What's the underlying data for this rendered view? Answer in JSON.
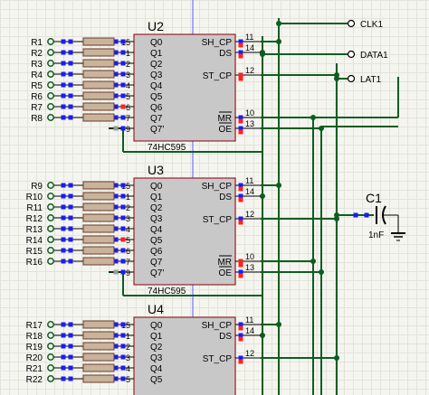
{
  "chips": [
    {
      "ref": "U2",
      "part": "74HC595",
      "left_pins": [
        {
          "num": "15",
          "name": "Q0"
        },
        {
          "num": "1",
          "name": "Q1"
        },
        {
          "num": "2",
          "name": "Q2"
        },
        {
          "num": "3",
          "name": "Q3"
        },
        {
          "num": "4",
          "name": "Q4"
        },
        {
          "num": "5",
          "name": "Q5"
        },
        {
          "num": "6",
          "name": "Q6"
        },
        {
          "num": "7",
          "name": "Q7"
        },
        {
          "num": "9",
          "name": "Q7'"
        }
      ],
      "right_pins": [
        {
          "num": "11",
          "name": "SH_CP"
        },
        {
          "num": "14",
          "name": "DS"
        },
        {
          "num": "12",
          "name": "ST_CP"
        },
        {
          "num": "10",
          "name": "MR"
        },
        {
          "num": "13",
          "name": "OE"
        }
      ],
      "resistors": [
        "R1",
        "R2",
        "R3",
        "R4",
        "R5",
        "R6",
        "R7",
        "R8"
      ]
    },
    {
      "ref": "U3",
      "part": "74HC595",
      "left_pins": [
        {
          "num": "15",
          "name": "Q0"
        },
        {
          "num": "1",
          "name": "Q1"
        },
        {
          "num": "2",
          "name": "Q2"
        },
        {
          "num": "3",
          "name": "Q3"
        },
        {
          "num": "4",
          "name": "Q4"
        },
        {
          "num": "5",
          "name": "Q5"
        },
        {
          "num": "6",
          "name": "Q6"
        },
        {
          "num": "7",
          "name": "Q7"
        },
        {
          "num": "9",
          "name": "Q7'"
        }
      ],
      "right_pins": [
        {
          "num": "11",
          "name": "SH_CP"
        },
        {
          "num": "14",
          "name": "DS"
        },
        {
          "num": "12",
          "name": "ST_CP"
        },
        {
          "num": "10",
          "name": "MR"
        },
        {
          "num": "13",
          "name": "OE"
        }
      ],
      "resistors": [
        "R9",
        "R10",
        "R11",
        "R12",
        "R13",
        "R14",
        "R15",
        "R16"
      ]
    },
    {
      "ref": "U4",
      "part": "",
      "left_pins": [
        {
          "num": "15",
          "name": "Q0"
        },
        {
          "num": "1",
          "name": "Q1"
        },
        {
          "num": "2",
          "name": "Q2"
        },
        {
          "num": "3",
          "name": "Q3"
        },
        {
          "num": "4",
          "name": "Q4"
        },
        {
          "num": "5",
          "name": "Q5"
        }
      ],
      "right_pins": [
        {
          "num": "11",
          "name": "SH_CP"
        },
        {
          "num": "14",
          "name": "DS"
        },
        {
          "num": "12",
          "name": "ST_CP"
        }
      ],
      "resistors": [
        "R17",
        "R18",
        "R19",
        "R20",
        "R21",
        "R22"
      ]
    }
  ],
  "terminals": [
    {
      "label": "CLK1"
    },
    {
      "label": "DATA1"
    },
    {
      "label": "LAT1"
    }
  ],
  "capacitor": {
    "ref": "C1",
    "value": "1nF"
  },
  "colors": {
    "wire": "#0b5e1f",
    "body_fill": "#c8c8c8",
    "body_stroke": "#8b0000",
    "pin_active": "#1a1aff",
    "pin_red": "#ff2020",
    "pin_gray": "#9a9a9a",
    "resistor_fill": "#c8b49a",
    "resistor_stroke": "#6b3a2a"
  }
}
